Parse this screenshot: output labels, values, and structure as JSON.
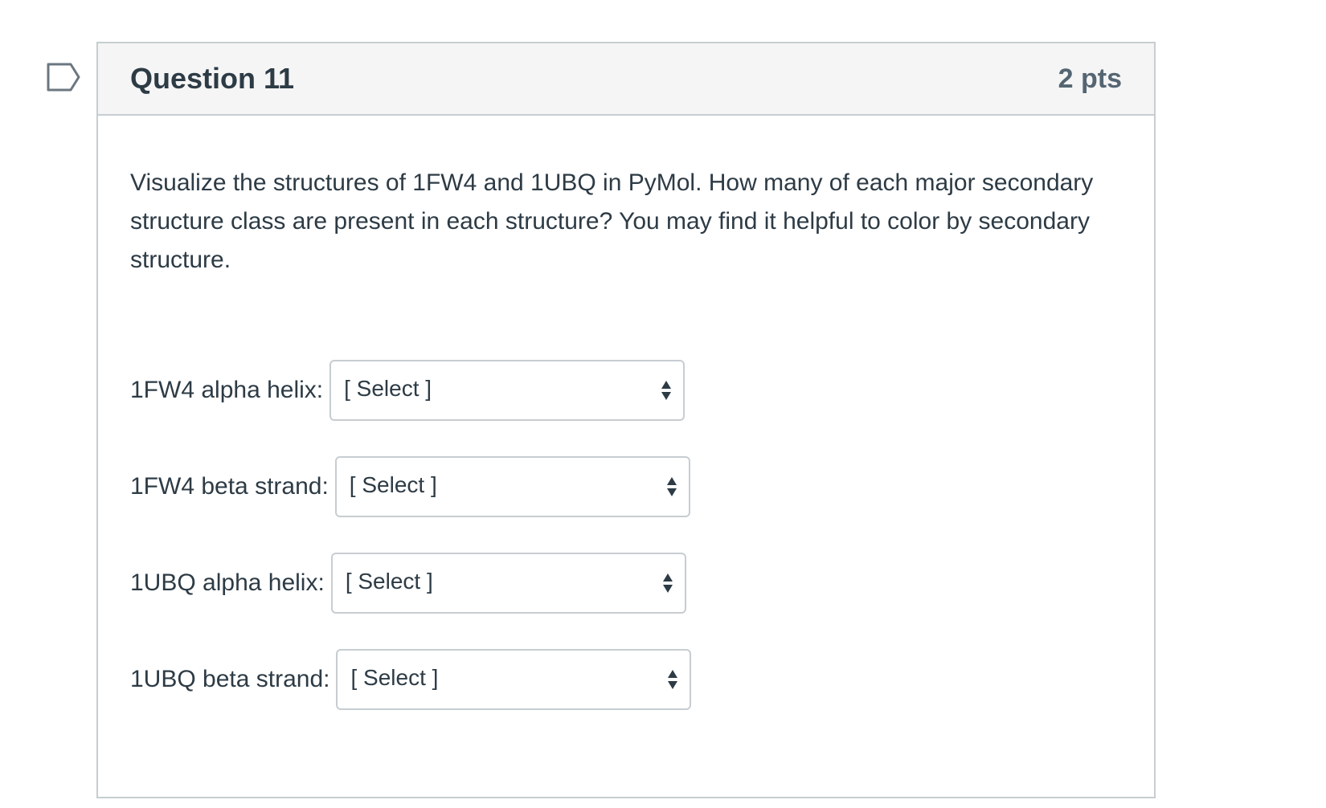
{
  "question": {
    "title": "Question 11",
    "points": "2 pts",
    "text": "Visualize the structures of 1FW4 and 1UBQ in PyMol. How many of each major secondary structure class are present in each structure? You may find it helpful to color by secondary structure."
  },
  "answers": [
    {
      "label": "1FW4 alpha helix:",
      "selected": "[ Select ]"
    },
    {
      "label": "1FW4 beta strand:",
      "selected": "[ Select ]"
    },
    {
      "label": "1UBQ alpha helix:",
      "selected": "[ Select ]"
    },
    {
      "label": "1UBQ beta strand:",
      "selected": "[ Select ]"
    }
  ],
  "icons": {
    "flag": "flag-question-icon",
    "select_arrows": "select-arrows-icon"
  },
  "colors": {
    "text": "#2d3b45",
    "header_bg": "#f5f5f5",
    "border": "#c7cdd1",
    "flag": "#6b7780"
  }
}
